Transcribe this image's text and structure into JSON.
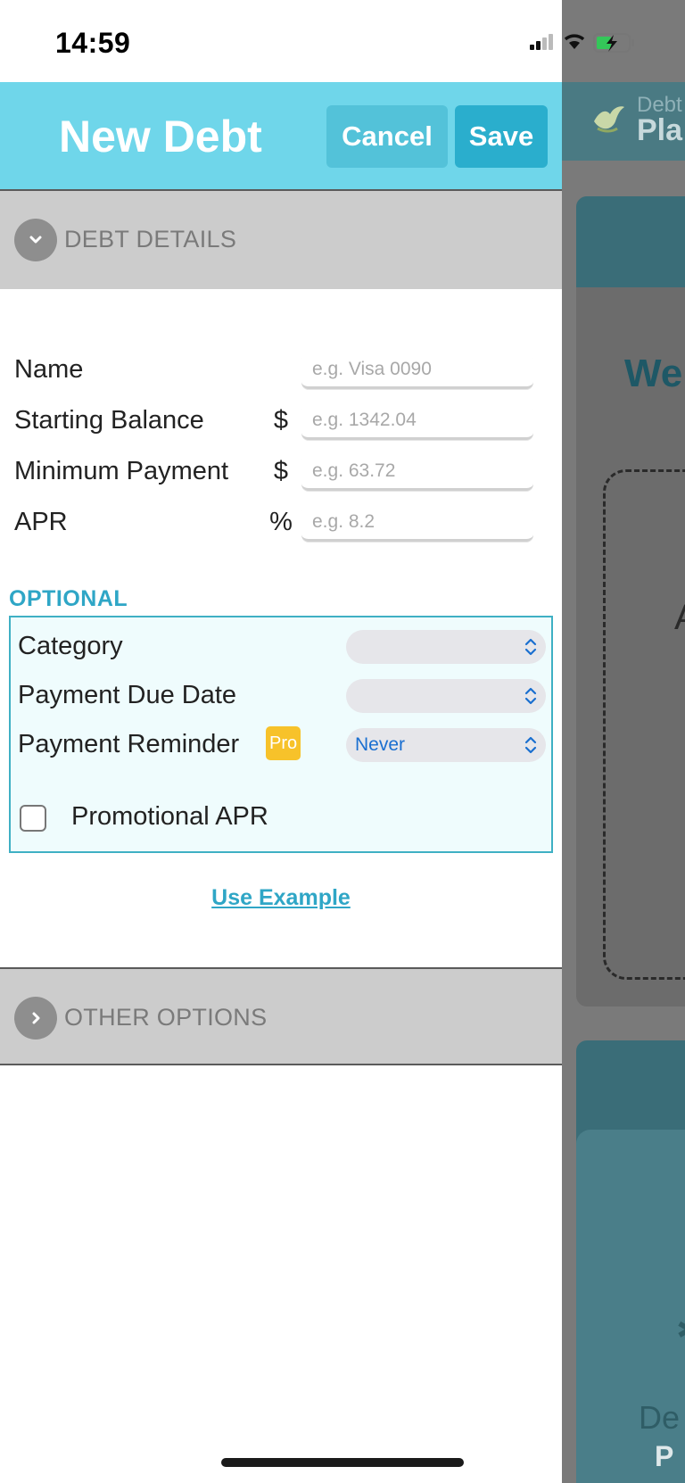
{
  "status_bar": {
    "time": "14:59"
  },
  "header": {
    "title": "New Debt",
    "cancel_label": "Cancel",
    "save_label": "Save"
  },
  "sections": {
    "debt_details": "DEBT DETAILS",
    "other_options": "OTHER OPTIONS"
  },
  "fields": [
    {
      "label": "Name",
      "unit": "",
      "placeholder": "e.g. Visa 0090",
      "value": ""
    },
    {
      "label": "Starting Balance",
      "unit": "$",
      "placeholder": "e.g. 1342.04",
      "value": ""
    },
    {
      "label": "Minimum Payment",
      "unit": "$",
      "placeholder": "e.g. 63.72",
      "value": ""
    },
    {
      "label": "APR",
      "unit": "%",
      "placeholder": "e.g. 8.2",
      "value": ""
    }
  ],
  "optional": {
    "heading": "OPTIONAL",
    "category_label": "Category",
    "category_value": "",
    "due_date_label": "Payment Due Date",
    "due_date_value": "",
    "reminder_label": "Payment Reminder",
    "reminder_badge": "Pro",
    "reminder_value": "Never",
    "promo_label": "Promotional APR",
    "promo_checked": false
  },
  "use_example": "Use Example",
  "background_app": {
    "logo_top": "Debt",
    "logo_bottom": "Pla",
    "welcome": "We",
    "letter": "A",
    "bottom_1": "De",
    "bottom_2": "P"
  },
  "colors": {
    "header_bg": "#6fd6ea",
    "accent": "#2fa6c6",
    "save_button": "#2aaecd",
    "cancel_button": "#53c2d9",
    "pro_badge": "#f7c22a",
    "section_bar": "#cccccc"
  },
  "icons": {
    "debt_details_toggle": "chevron-down-icon",
    "other_options_toggle": "chevron-right-icon"
  }
}
